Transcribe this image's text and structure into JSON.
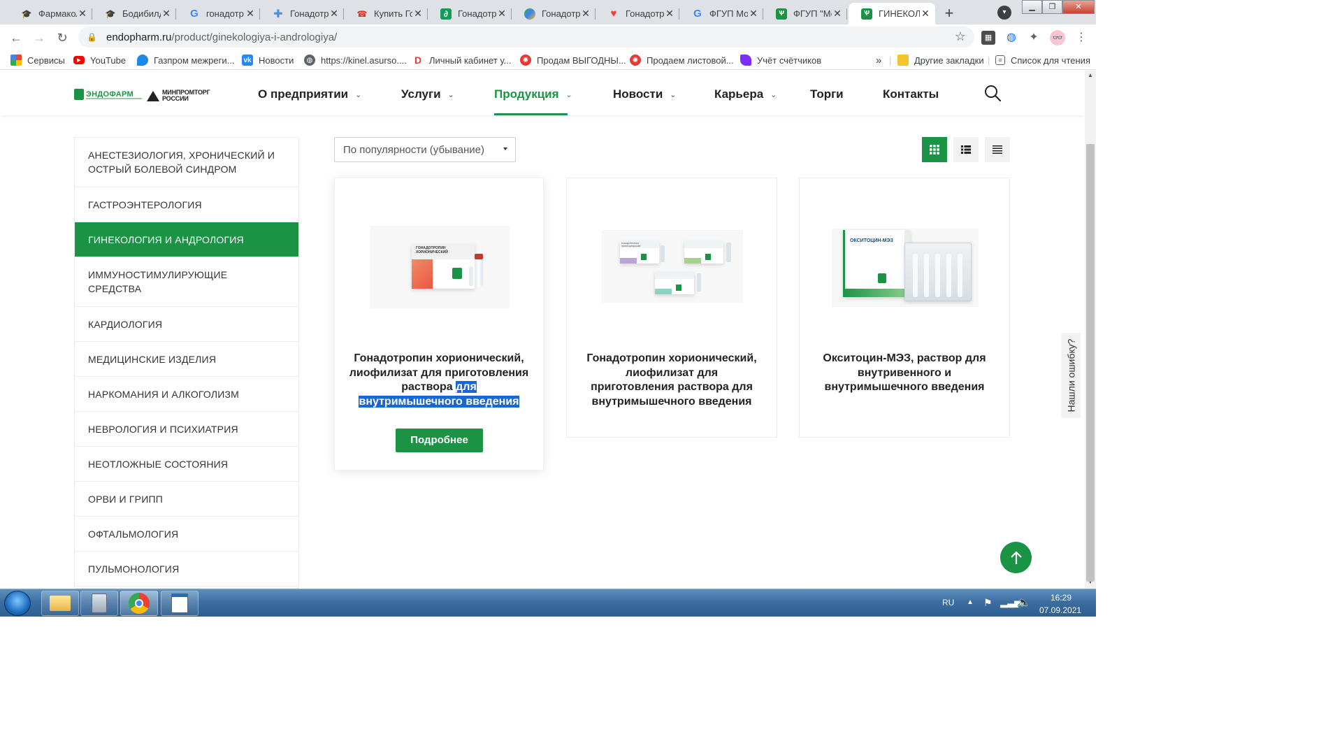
{
  "browser": {
    "tabs": [
      {
        "title": "Фармакол",
        "icon": "hat-icon",
        "color": "#3c4043"
      },
      {
        "title": "Бодибилд",
        "icon": "hat-icon",
        "color": "#3c4043"
      },
      {
        "title": "гонадотр",
        "icon": "google-icon",
        "color": "#4285f4"
      },
      {
        "title": "Гонадотр",
        "icon": "medical-cross-icon",
        "color": "#4a90e2"
      },
      {
        "title": "Купить Го",
        "icon": "phone-icon",
        "color": "#d93025"
      },
      {
        "title": "Гонадотр",
        "icon": "green-leaf-icon",
        "color": "#0f9d58"
      },
      {
        "title": "Гонадотр",
        "icon": "colorful-leaf-icon",
        "color": "#34a853"
      },
      {
        "title": "Гонадотр",
        "icon": "heart-icon",
        "color": "#ea4335"
      },
      {
        "title": "ФГУП Мо",
        "icon": "google-icon",
        "color": "#4285f4"
      },
      {
        "title": "ФГУП \"Мо",
        "icon": "endopharm-icon",
        "color": "#1a9444"
      },
      {
        "title": "ГИНЕКОЛ",
        "icon": "endopharm-icon",
        "color": "#1a9444"
      }
    ],
    "url_host": "endopharm.ru",
    "url_path": "/product/ginekologiya-i-andrologiya/",
    "bookmarks": [
      {
        "label": "Сервисы",
        "icon": "apps-grid-icon",
        "color": "#ea4335"
      },
      {
        "label": "YouTube",
        "icon": "youtube-icon",
        "color": "#ff0000"
      },
      {
        "label": "Газпром межреги...",
        "icon": "gazprom-flame-icon",
        "color": "#1e88e5"
      },
      {
        "label": "Новости",
        "icon": "vk-icon",
        "color": "#2787f5"
      },
      {
        "label": "https://kinel.asurso....",
        "icon": "globe-icon",
        "color": "#5f6368"
      },
      {
        "label": "Личный кабинет у...",
        "icon": "d-logo-icon",
        "color": "#e53935"
      },
      {
        "label": "Продам ВЫГОДНЫ...",
        "icon": "avito-icon",
        "color": "#e53935"
      },
      {
        "label": "Продаем листовой...",
        "icon": "avito-icon",
        "color": "#e53935"
      },
      {
        "label": "Учёт счётчиков",
        "icon": "feather-icon",
        "color": "#7b2ff7"
      }
    ],
    "bookmarks_more": "»",
    "other_bookmarks": "Другие закладки",
    "reading_list": "Список для чтения"
  },
  "site": {
    "logo_text": "ЭНДОФАРМ",
    "ministry_logo": "МИНПРОМТОРГ РОССИИ",
    "menu": [
      {
        "label": "О предприятии",
        "chevron": true
      },
      {
        "label": "Услуги",
        "chevron": true
      },
      {
        "label": "Продукция",
        "chevron": true,
        "active": true
      },
      {
        "label": "Новости",
        "chevron": true
      },
      {
        "label": "Карьера",
        "chevron": true
      },
      {
        "label": "Торги",
        "chevron": false
      },
      {
        "label": "Контакты",
        "chevron": false
      }
    ],
    "accent_color": "#1a9444"
  },
  "sidebar": {
    "categories": [
      {
        "label": "АНЕСТЕЗИОЛОГИЯ, ХРОНИЧЕСКИЙ И ОСТРЫЙ БОЛЕВОЙ СИНДРОМ"
      },
      {
        "label": "ГАСТРОЭНТЕРОЛОГИЯ"
      },
      {
        "label": "ГИНЕКОЛОГИЯ И АНДРОЛОГИЯ",
        "active": true
      },
      {
        "label": "ИММУНОСТИМУЛИРУЮЩИЕ СРЕДСТВА"
      },
      {
        "label": "КАРДИОЛОГИЯ"
      },
      {
        "label": "МЕДИЦИНСКИЕ ИЗДЕЛИЯ"
      },
      {
        "label": "НАРКОМАНИЯ И АЛКОГОЛИЗМ"
      },
      {
        "label": "НЕВРОЛОГИЯ И ПСИХИАТРИЯ"
      },
      {
        "label": "НЕОТЛОЖНЫЕ СОСТОЯНИЯ"
      },
      {
        "label": "ОРВИ И ГРИПП"
      },
      {
        "label": "ОФТАЛЬМОЛОГИЯ"
      },
      {
        "label": "ПУЛЬМОНОЛОГИЯ"
      }
    ]
  },
  "catalog": {
    "sort_value": "По популярности (убывание)",
    "view_modes": [
      "grid",
      "list",
      "compact"
    ],
    "active_view": "grid",
    "products": [
      {
        "title_plain": "Гонадотропин хорионический, лиофилизат для приготовления раствора",
        "title_selected": "для внутримышечного введения",
        "package_text": "ГОНАДОТРОПИН ХОРИОНИЧЕСКИЙ",
        "button": "Подробнее"
      },
      {
        "title": "Гонадотропин хорионический, лиофилизат для приготовления раствора для внутримышечного введения",
        "package_text": "ГОНАДОТРОПИН ХОРИОНИЧЕСКИЙ"
      },
      {
        "title": "Окситоцин-МЭЗ, раствор для внутривенного и внутримышечного введения",
        "package_text": "ОКСИТОЦИН-МЭЗ"
      }
    ]
  },
  "widgets": {
    "error_tab": "Нашли ошибку?"
  },
  "taskbar": {
    "lang": "RU",
    "time": "16:29",
    "date": "07.09.2021"
  }
}
